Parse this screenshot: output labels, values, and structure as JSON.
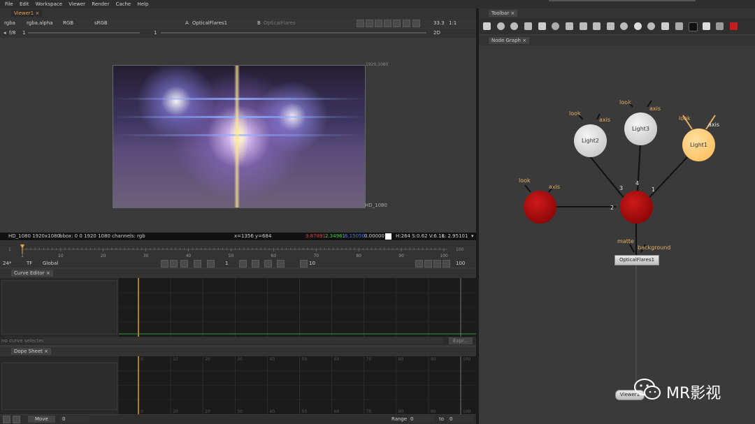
{
  "menu": [
    "File",
    "Edit",
    "Workspace",
    "Viewer",
    "Render",
    "Cache",
    "Help"
  ],
  "viewer": {
    "tab": "Viewer1",
    "channels": "rgba",
    "alpha": "rgba.alpha",
    "colorspace": "RGB",
    "lut": "sRGB",
    "input_a_label": "A",
    "input_a": "OpticalFlares1",
    "input_b_label": "B",
    "input_b": "OpticalFlares",
    "gain": "f/8",
    "gain_value": "1",
    "gamma_value": "1",
    "zoom": "33.3",
    "ratio": "1:1",
    "mode": "2D",
    "format_top": "1920,1080",
    "format_bottom": "HD_1080"
  },
  "infobar": {
    "format": "HD_1080 1920x1080",
    "bbox": "bbox: 0 0 1920 1080 channels: rgb",
    "coords": "x=1356 y=684",
    "r": "3.87891",
    "g": "2.34961",
    "b": "6.15050",
    "a": "0.00000",
    "hsv": "H:264 S:0.62 V:6.18",
    "lum": "L: 2.95101"
  },
  "timeline": {
    "frame_start": "1",
    "frame_end": "100",
    "ticks": [
      "1",
      "10",
      "20",
      "30",
      "40",
      "50",
      "60",
      "70",
      "80",
      "90",
      "100"
    ],
    "fps": "24*",
    "tf": "TF",
    "scope": "Global",
    "current_frame": "1",
    "step": "10",
    "end": "100"
  },
  "curve_editor": {
    "tab": "Curve Editor",
    "status": "no curve selected",
    "button": "Expr..."
  },
  "dope_sheet": {
    "tab": "Dope Sheet",
    "ticks": [
      "0",
      "10",
      "20",
      "30",
      "40",
      "50",
      "60",
      "70",
      "80",
      "90",
      "100"
    ],
    "move_label": "Move",
    "move_value": "0",
    "range_label": "Range",
    "range_from": "0",
    "to_label": "to",
    "range_to": "0"
  },
  "toolbar": {
    "tab": "Toolbar"
  },
  "node_graph": {
    "tab": "Node Graph",
    "nodes": {
      "light1": "Light1",
      "light2": "Light2",
      "light3": "Light3",
      "optical": "OpticalFlares1",
      "viewer": "Viewer1"
    },
    "labels": {
      "look": "look",
      "axis": "axis",
      "matte": "matte",
      "background": "background"
    },
    "inputs": [
      "1",
      "2",
      "3",
      "4"
    ]
  },
  "watermark": "MR影视",
  "colors": {
    "accent": "#f0a050",
    "node_red": "#8b0000",
    "light_gray": "#dcdcdc",
    "light_orange": "#ffc670"
  }
}
